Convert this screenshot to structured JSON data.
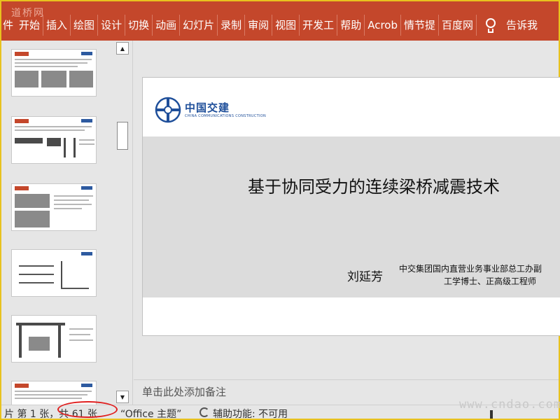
{
  "ribbon": {
    "watermark": "道桥网",
    "tabs": [
      "件",
      "开始",
      "插入",
      "绘图",
      "设计",
      "切换",
      "动画",
      "幻灯片",
      "录制",
      "审阅",
      "视图",
      "开发工",
      "帮助",
      "Acrob",
      "情节提",
      "百度网"
    ],
    "tell_me": "告诉我"
  },
  "slide": {
    "logo_cn": "中国交建",
    "logo_en": "CHINA COMMUNICATIONS CONSTRUCTION",
    "title": "基于协同受力的连续梁桥减震技术",
    "author": "刘延芳",
    "affiliation_line1": "中交集团国内直营业务事业部总工办副",
    "affiliation_line2": "工学博士、正高级工程师"
  },
  "notes": {
    "placeholder": "单击此处添加备注"
  },
  "status": {
    "slide_info": "片 第 1 张，共 61 张",
    "theme": "“Office 主题”",
    "accessibility": "辅助功能: 不可用"
  },
  "watermark_bottom": "www.cndao.com",
  "colors": {
    "ribbon": "#c4472b",
    "logo_blue": "#1f4f9a",
    "highlight_circle": "#e02020"
  }
}
